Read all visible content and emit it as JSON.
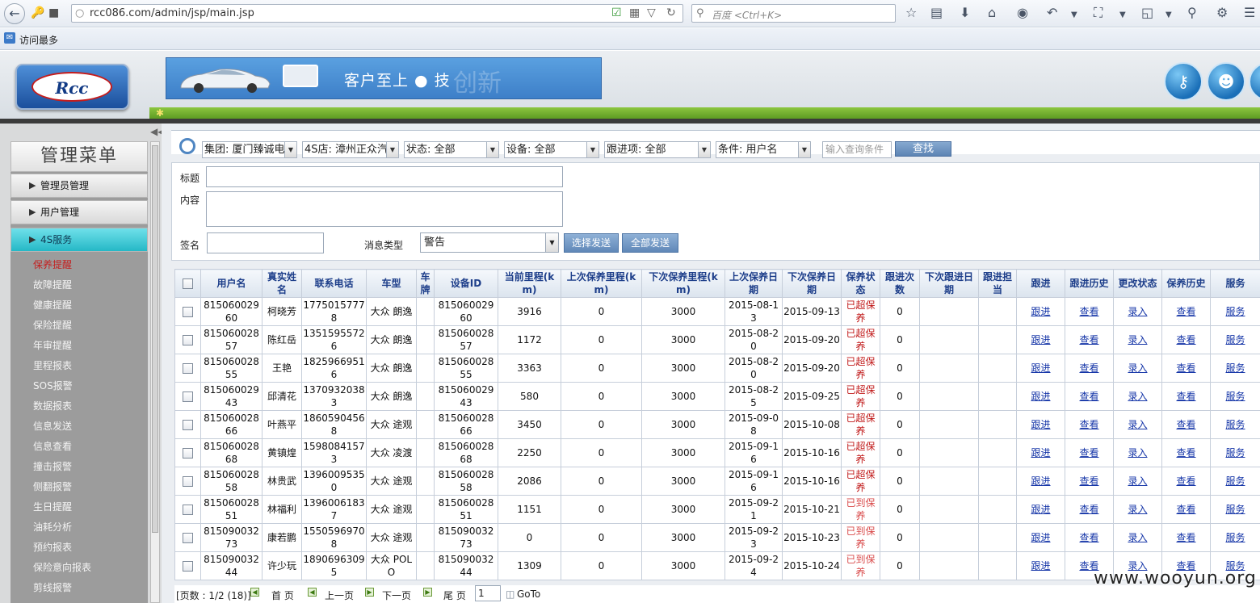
{
  "browser": {
    "url": "rcc086.com/admin/jsp/main.jsp",
    "search_placeholder": "百度 <Ctrl+K>",
    "bookmark_label": "访问最多"
  },
  "header": {
    "logo_text": "Rcc",
    "banner_text": "客户至上 ● 技",
    "banner_ghost": "创新"
  },
  "sidebar": {
    "title": "管理菜单",
    "groups": [
      {
        "label": "管理员管理"
      },
      {
        "label": "用户管理"
      },
      {
        "label": "4S服务"
      }
    ],
    "items": [
      {
        "label": "保养提醒"
      },
      {
        "label": "故障提醒"
      },
      {
        "label": "健康提醒"
      },
      {
        "label": "保险提醒"
      },
      {
        "label": "年审提醒"
      },
      {
        "label": "里程报表"
      },
      {
        "label": "SOS报警"
      },
      {
        "label": "数据报表"
      },
      {
        "label": "信息发送"
      },
      {
        "label": "信息查看"
      },
      {
        "label": "撞击报警"
      },
      {
        "label": "侧翻报警"
      },
      {
        "label": "生日提醒"
      },
      {
        "label": "油耗分析"
      },
      {
        "label": "预约报表"
      },
      {
        "label": "保险意向报表"
      },
      {
        "label": "剪线报警"
      }
    ]
  },
  "filters": {
    "group": "集团: 厦门臻诚电",
    "shop": "4S店: 漳州正众汽",
    "status": "状态: 全部",
    "device": "设备: 全部",
    "follow_item": "跟进项: 全部",
    "condition": "条件: 用户名",
    "query_placeholder": "输入查询条件",
    "find_label": "查找"
  },
  "form": {
    "title_label": "标题",
    "content_label": "内容",
    "sign_label": "签名",
    "msgtype_label": "消息类型",
    "msgtype_value": "警告",
    "send_selected": "选择发送",
    "send_all": "全部发送"
  },
  "table": {
    "headers": [
      "用户名",
      "真实姓名",
      "联系电话",
      "车型",
      "车牌",
      "设备ID",
      "当前里程(km)",
      "上次保养里程(km)",
      "下次保养里程(km)",
      "上次保养日期",
      "下次保养日期",
      "保养状态",
      "跟进次数",
      "下次跟进日期",
      "跟进担当",
      "跟进",
      "跟进历史",
      "更改状态",
      "保养历史",
      "服务"
    ],
    "link_labels": {
      "follow": "跟进",
      "history": "查看",
      "status": "录入",
      "maint": "查看",
      "service": "服务"
    },
    "rows": [
      {
        "user": "81506002960",
        "name": "柯晓芳",
        "phone": "17750157778",
        "model": "大众 朗逸",
        "plate": "",
        "device": "81506002960",
        "mileage": "3916",
        "last_km": "0",
        "next_km": "3000",
        "last_date": "2015-08-13",
        "next_date": "2015-09-13",
        "status": "已超保养",
        "count": "0"
      },
      {
        "user": "81506002857",
        "name": "陈红岳",
        "phone": "13515955726",
        "model": "大众 朗逸",
        "plate": "",
        "device": "81506002857",
        "mileage": "1172",
        "last_km": "0",
        "next_km": "3000",
        "last_date": "2015-08-20",
        "next_date": "2015-09-20",
        "status": "已超保养",
        "count": "0"
      },
      {
        "user": "81506002855",
        "name": "王艳",
        "phone": "18259669516",
        "model": "大众 朗逸",
        "plate": "",
        "device": "81506002855",
        "mileage": "3363",
        "last_km": "0",
        "next_km": "3000",
        "last_date": "2015-08-20",
        "next_date": "2015-09-20",
        "status": "已超保养",
        "count": "0"
      },
      {
        "user": "81506002943",
        "name": "邱清花",
        "phone": "13709320383",
        "model": "大众 朗逸",
        "plate": "",
        "device": "81506002943",
        "mileage": "580",
        "last_km": "0",
        "next_km": "3000",
        "last_date": "2015-08-25",
        "next_date": "2015-09-25",
        "status": "已超保养",
        "count": "0"
      },
      {
        "user": "81506002866",
        "name": "叶燕平",
        "phone": "18605904568",
        "model": "大众 途观",
        "plate": "",
        "device": "81506002866",
        "mileage": "3450",
        "last_km": "0",
        "next_km": "3000",
        "last_date": "2015-09-08",
        "next_date": "2015-10-08",
        "status": "已超保养",
        "count": "0"
      },
      {
        "user": "81506002868",
        "name": "黄镇煌",
        "phone": "15980841573",
        "model": "大众 凌渡",
        "plate": "",
        "device": "81506002868",
        "mileage": "2250",
        "last_km": "0",
        "next_km": "3000",
        "last_date": "2015-09-16",
        "next_date": "2015-10-16",
        "status": "已超保养",
        "count": "0"
      },
      {
        "user": "81506002858",
        "name": "林贵武",
        "phone": "13960095350",
        "model": "大众 途观",
        "plate": "",
        "device": "81506002858",
        "mileage": "2086",
        "last_km": "0",
        "next_km": "3000",
        "last_date": "2015-09-16",
        "next_date": "2015-10-16",
        "status": "已超保养",
        "count": "0"
      },
      {
        "user": "81506002851",
        "name": "林福利",
        "phone": "13960061837",
        "model": "大众 途观",
        "plate": "",
        "device": "81506002851",
        "mileage": "1151",
        "last_km": "0",
        "next_km": "3000",
        "last_date": "2015-09-21",
        "next_date": "2015-10-21",
        "status": "已到保养",
        "count": "0"
      },
      {
        "user": "81509003273",
        "name": "康若鹏",
        "phone": "15505969708",
        "model": "大众 途观",
        "plate": "",
        "device": "81509003273",
        "mileage": "0",
        "last_km": "0",
        "next_km": "3000",
        "last_date": "2015-09-23",
        "next_date": "2015-10-23",
        "status": "已到保养",
        "count": "0"
      },
      {
        "user": "81509003244",
        "name": "许少玩",
        "phone": "18906963095",
        "model": "大众 POLO",
        "plate": "",
        "device": "81509003244",
        "mileage": "1309",
        "last_km": "0",
        "next_km": "3000",
        "last_date": "2015-09-24",
        "next_date": "2015-10-24",
        "status": "已到保养",
        "count": "0"
      }
    ]
  },
  "pager": {
    "info": "[页数 : 1/2 (18)]",
    "first": "首 页",
    "prev": "上一页",
    "next": "下一页",
    "last": "尾 页",
    "page_value": "1",
    "goto": "GoTo"
  },
  "watermark": "www.wooyun.org"
}
